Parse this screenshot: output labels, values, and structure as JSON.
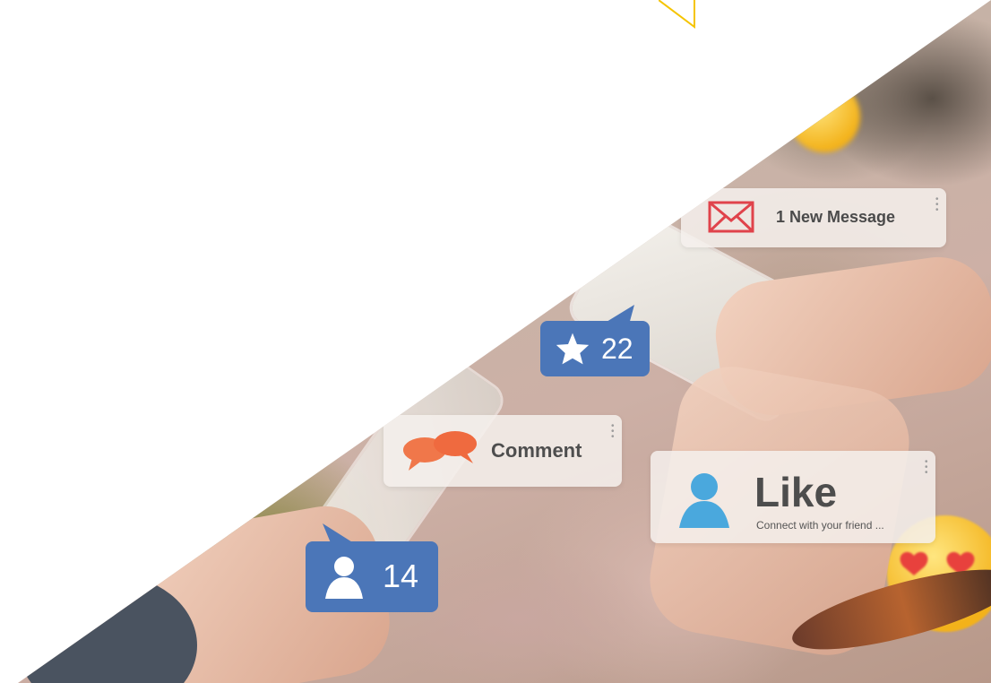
{
  "notifications": {
    "message": {
      "label": "1 New Message",
      "icon": "envelope-icon",
      "icon_color": "#e0434b"
    },
    "comment": {
      "label": "Comment",
      "icon": "speech-bubbles-icon",
      "icon_color": "#f0774a"
    },
    "like": {
      "title": "Like",
      "subtitle": "Connect with your friend ...",
      "icon": "user-icon",
      "icon_color": "#4aa8dd"
    }
  },
  "badges": {
    "star": {
      "count": "22",
      "icon": "star-icon",
      "color": "#4b76b8"
    },
    "user": {
      "count": "14",
      "icon": "user-icon",
      "color": "#4b76b8"
    }
  },
  "accent_color": "#f5c400"
}
